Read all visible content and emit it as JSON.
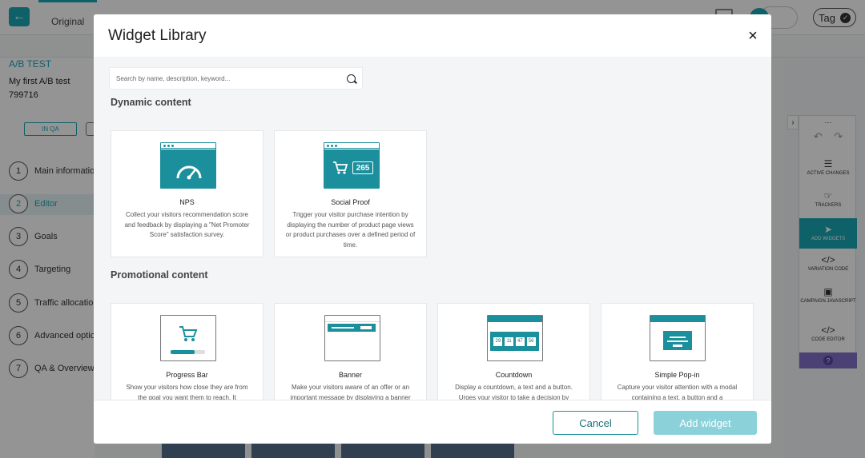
{
  "app": {
    "original_tab": "Original",
    "tag_button": "Tag",
    "campaign_type": "A/B TEST",
    "campaign_name": "My first A/B test",
    "campaign_id": "799716",
    "status_badge": "IN QA",
    "steps": [
      {
        "num": "1",
        "label": "Main information"
      },
      {
        "num": "2",
        "label": "Editor"
      },
      {
        "num": "3",
        "label": "Goals"
      },
      {
        "num": "4",
        "label": "Targeting"
      },
      {
        "num": "5",
        "label": "Traffic allocation"
      },
      {
        "num": "6",
        "label": "Advanced options"
      },
      {
        "num": "7",
        "label": "QA & Overview"
      }
    ],
    "active_step": "2"
  },
  "toolbar": {
    "items": [
      {
        "label": "ACTIVE CHANGES",
        "icon": "list-icon"
      },
      {
        "label": "TRACKERS",
        "icon": "pointer-icon"
      },
      {
        "label": "ADD WIDGETS",
        "icon": "rocket-icon",
        "active": true
      },
      {
        "label": "VARIATION CODE",
        "icon": "code-icon"
      },
      {
        "label": "CAMPAIGN JAVASCRIPT",
        "icon": "js-icon"
      },
      {
        "label": "CODE EDITOR",
        "icon": "code-icon"
      }
    ],
    "help": "?"
  },
  "modal": {
    "title": "Widget Library",
    "close": "×",
    "search_placeholder": "Search by name, description, keyword...",
    "sections": [
      {
        "title": "Dynamic content",
        "cards": [
          {
            "name": "NPS",
            "description": "Collect your visitors recommendation score and feedback by displaying a \"Net Promoter Score\" satisfaction survey.",
            "icon": "gauge-icon"
          },
          {
            "name": "Social Proof",
            "description": "Trigger your visitor purchase intention by displaying the number of product page views or product purchases over a defined period of time.",
            "icon": "cart-counter-icon",
            "counter": "265"
          }
        ]
      },
      {
        "title": "Promotional content",
        "cards": [
          {
            "name": "Progress Bar",
            "description": "Show your visitors how close they are from the goal you want them to reach. It",
            "icon": "cart-progress-icon"
          },
          {
            "name": "Banner",
            "description": "Make your visitors aware of an offer or an important message by displaying a banner",
            "icon": "banner-icon"
          },
          {
            "name": "Countdown",
            "description": "Display a countdown, a text and a button. Urges your visitor to take a decision by",
            "icon": "countdown-icon",
            "digits": [
              "29",
              "11",
              "47",
              "56"
            ]
          },
          {
            "name": "Simple Pop-in",
            "description": "Capture your visitor attention with a modal containing a text, a button and a",
            "icon": "popin-icon"
          }
        ]
      }
    ],
    "cancel_label": "Cancel",
    "add_label": "Add widget"
  },
  "colors": {
    "accent": "#1ba7b6",
    "illustration": "#1b8f9b",
    "add_disabled": "#8bd1d9"
  }
}
